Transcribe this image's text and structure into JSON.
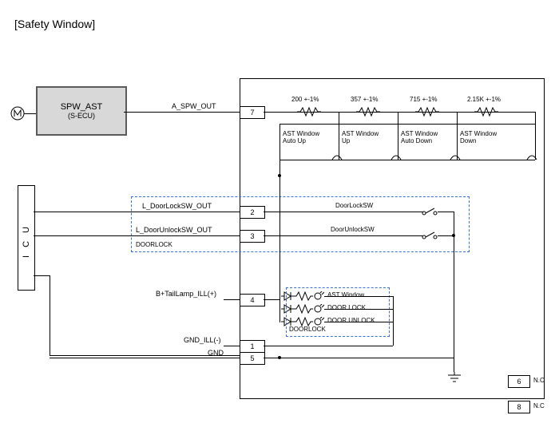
{
  "title": "[Safety Window]",
  "ecu": {
    "name": "SPW_AST",
    "sub": "(S-ECU)"
  },
  "icu": "ICU",
  "signals": {
    "a_spw_out": "A_SPW_OUT",
    "l_doorlock_out": "L_DoorLockSW_OUT",
    "l_doorunlock_out": "L_DoorUnlockSW_OUT",
    "doorlock_group": "DOORLOCK",
    "b_tail_ill": "B+TailLamp_ILL(+)",
    "gnd_ill": "GND_ILL(-)",
    "gnd": "GND"
  },
  "pins": {
    "p1": "1",
    "p2": "2",
    "p3": "3",
    "p4": "4",
    "p5": "5",
    "p6": "6",
    "p7": "7",
    "p8": "8"
  },
  "resistors": {
    "r1": "200 +-1%",
    "r2": "357 +-1%",
    "r3": "715 +-1%",
    "r4": "2.15K +-1%"
  },
  "ast_switches": {
    "sw1": "AST Window Auto Up",
    "sw1_l1": "AST Window",
    "sw1_l2": "Auto Up",
    "sw2_l1": "AST Window",
    "sw2_l2": "Up",
    "sw3_l1": "AST Window",
    "sw3_l2": "Auto Down",
    "sw4_l1": "AST Window",
    "sw4_l2": "Down"
  },
  "door_sw": {
    "lock": "DoorLockSW",
    "unlock": "DoorUnlockSW"
  },
  "ill_labels": {
    "ast": "AST Window",
    "lock": "DOOR LOCK",
    "unlock": "DOOR UNLOCK",
    "group": "DOORLOCK"
  },
  "nc": "N.C",
  "chart_data": {
    "type": "schematic",
    "title": "Safety Window wiring diagram",
    "modules": [
      "SPW_AST (S-ECU)",
      "ICU"
    ],
    "connector_pins": [
      {
        "pin": 7,
        "signal": "A_SPW_OUT",
        "to": "AST Window switch resistor ladder"
      },
      {
        "pin": 2,
        "signal": "L_DoorLockSW_OUT",
        "to": "DoorLockSW"
      },
      {
        "pin": 3,
        "signal": "L_DoorUnlockSW_OUT",
        "to": "DoorUnlockSW"
      },
      {
        "pin": 4,
        "signal": "B+TailLamp_ILL(+)",
        "to": "Illumination LEDs (AST Window / DOOR LOCK / DOOR UNLOCK)"
      },
      {
        "pin": 1,
        "signal": "GND_ILL(-)"
      },
      {
        "pin": 5,
        "signal": "GND"
      },
      {
        "pin": 6,
        "signal": "N.C"
      },
      {
        "pin": 8,
        "signal": "N.C"
      }
    ],
    "resistor_ladder": [
      {
        "value_ohm": 200,
        "tolerance_pct": 1,
        "switch": "AST Window Auto Up"
      },
      {
        "value_ohm": 357,
        "tolerance_pct": 1,
        "switch": "AST Window Up"
      },
      {
        "value_ohm": 715,
        "tolerance_pct": 1,
        "switch": "AST Window Auto Down"
      },
      {
        "value_ohm": 2150,
        "tolerance_pct": 1,
        "switch": "AST Window Down"
      }
    ]
  }
}
